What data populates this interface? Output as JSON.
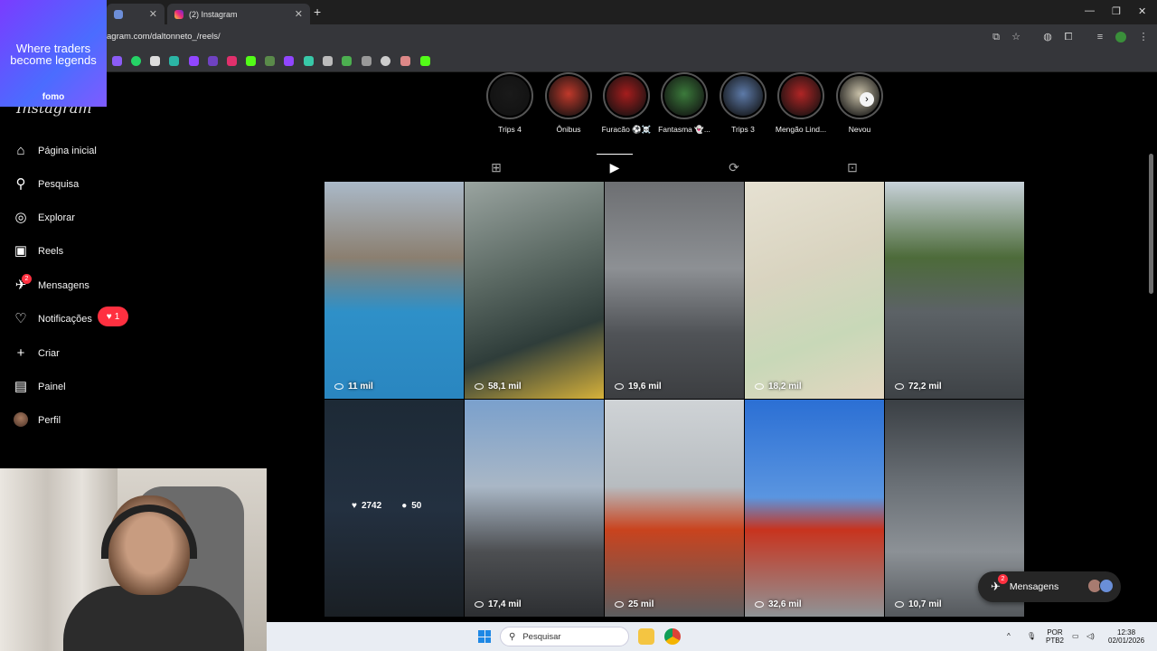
{
  "browser": {
    "tabs": [
      {
        "label": ""
      },
      {
        "label": "(2) Instagram"
      }
    ],
    "url": "agram.com/daltonneto_/reels/"
  },
  "ad": {
    "tagline": "Where traders become legends",
    "brand": "fomo"
  },
  "sidebar": {
    "logo": "Instagram",
    "items": [
      {
        "label": "Página inicial",
        "icon": "home-icon"
      },
      {
        "label": "Pesquisa",
        "icon": "search-icon"
      },
      {
        "label": "Explorar",
        "icon": "compass-icon"
      },
      {
        "label": "Reels",
        "icon": "reels-icon"
      },
      {
        "label": "Mensagens",
        "icon": "messenger-icon",
        "badge": "2"
      },
      {
        "label": "Notificações",
        "icon": "heart-icon"
      },
      {
        "label": "Criar",
        "icon": "plus-icon"
      },
      {
        "label": "Painel",
        "icon": "dashboard-icon"
      },
      {
        "label": "Perfil",
        "icon": "avatar"
      }
    ],
    "notif_count": "1"
  },
  "stories": [
    {
      "label": "Trips 4",
      "color": "#1a1a1a"
    },
    {
      "label": "Ônibus",
      "color": "#c0392b"
    },
    {
      "label": "Furacão ⚽️☠️",
      "color": "#a51d1d"
    },
    {
      "label": "Fantasma 👻...",
      "color": "#3b7a3b"
    },
    {
      "label": "Trips 3",
      "color": "#5d7aa8"
    },
    {
      "label": "Mengão Lind...",
      "color": "#b02525"
    },
    {
      "label": "Nevou",
      "color": "#c8c0a8"
    }
  ],
  "profile_tabs": [
    "posts-grid-icon",
    "reels-icon",
    "reposts-icon",
    "tagged-icon"
  ],
  "reels": [
    {
      "views": "11 mil",
      "bg": "linear-gradient(180deg,#aab9c8 0%,#8b7f70 35%,#2e90c8 60%,#2a86c0 100%)"
    },
    {
      "views": "58,1 mil",
      "bg": "linear-gradient(160deg,#9aa4a0 0%,#5c6a64 40%,#2f3d3a 70%,#d6b13a 100%)"
    },
    {
      "views": "19,6 mil",
      "bg": "linear-gradient(180deg,#6d6f72 0%,#8d9094 40%,#505357 70%,#3c3e41 100%)"
    },
    {
      "views": "18,2 mil",
      "bg": "linear-gradient(160deg,#e6e1d2 0%,#d9d4c0 40%,#c8d8b8 70%,#e3d6c0 100%)"
    },
    {
      "views": "72,2 mil",
      "bg": "linear-gradient(180deg,#c8d2da 0%,#4d6b3a 35%,#5c6266 60%,#3e4246 100%)"
    },
    {
      "views": "",
      "bg": "linear-gradient(180deg,#1d2a36 0%,#233040 50%,#1a1f24 100%)"
    },
    {
      "views": "17,4 mil",
      "bg": "linear-gradient(180deg,#7aa0cc 0%,#a9b7c6 40%,#4d4f52 70%,#2d2f32 100%)"
    },
    {
      "views": "25 mil",
      "bg": "linear-gradient(180deg,#cfd3d6 0%,#b7bcc0 40%,#c9431e 60%,#5d5e60 100%)"
    },
    {
      "views": "32,6 mil",
      "bg": "linear-gradient(180deg,#2b6fd4 0%,#5a95e0 45%,#c8331e 60%,#8f9396 100%)"
    },
    {
      "views": "10,7 mil",
      "bg": "linear-gradient(180deg,#3a3f44 0%,#6b7177 40%,#8c9196 70%,#55595d 100%)"
    }
  ],
  "hover": {
    "likes": "2742",
    "comments": "50"
  },
  "messages_button": {
    "label": "Mensagens",
    "badge": "2"
  },
  "taskbar": {
    "search_placeholder": "Pesquisar",
    "lang": "POR",
    "layout": "PTB2",
    "time": "12:38",
    "date": "02/01/2026"
  },
  "colors": {
    "accent_red": "#ff3040",
    "ig_bg": "#000000",
    "chrome_dark": "#35363a"
  }
}
